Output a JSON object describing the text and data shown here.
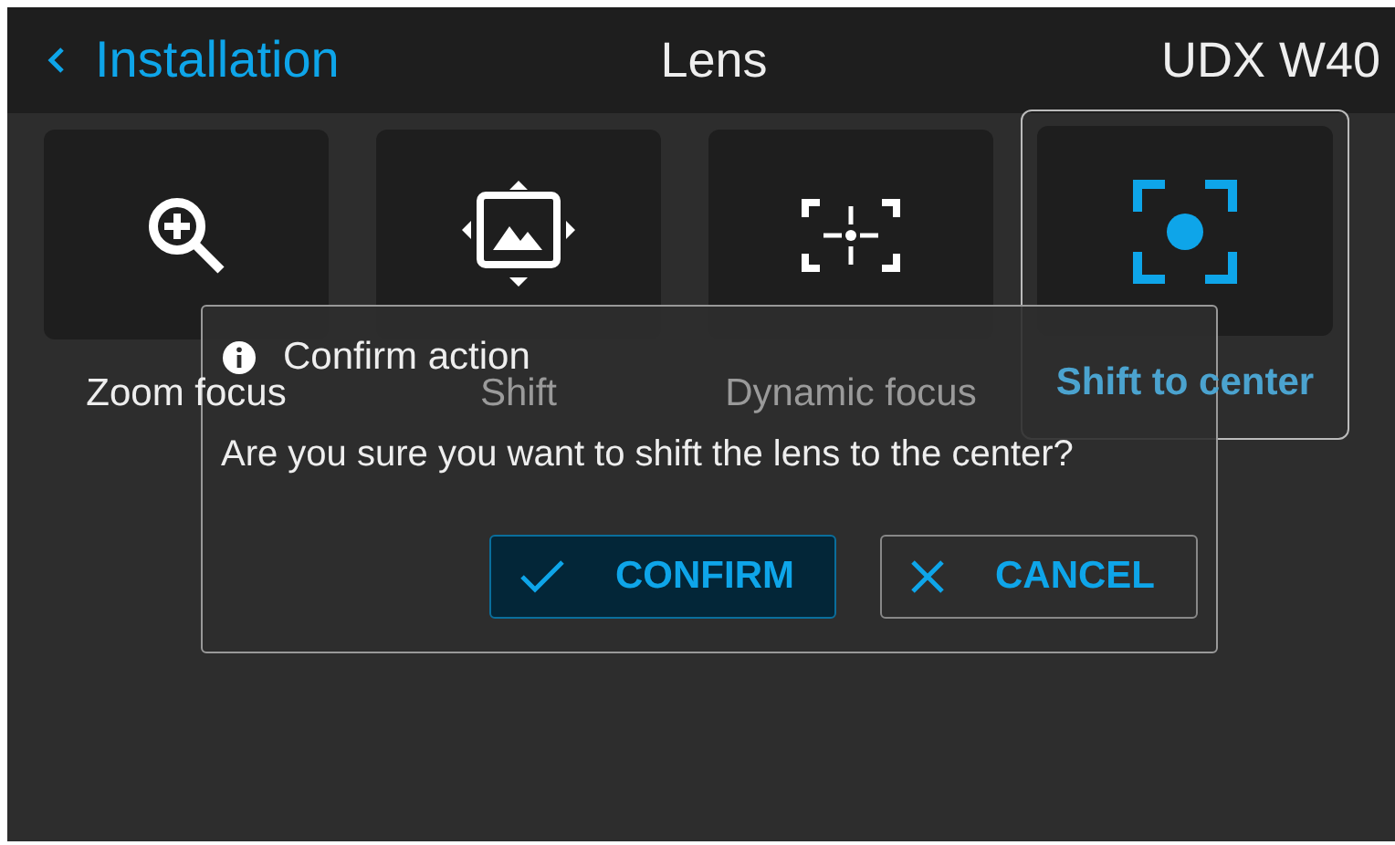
{
  "header": {
    "back_label": "Installation",
    "title": "Lens",
    "device": "UDX W40"
  },
  "tiles": [
    {
      "kind": "zoom",
      "label": "Zoom focus",
      "selected": false,
      "dimmed": false
    },
    {
      "kind": "shift",
      "label": "Shift",
      "selected": false,
      "dimmed": true
    },
    {
      "kind": "dynamic",
      "label": "Dynamic focus",
      "selected": false,
      "dimmed": true
    },
    {
      "kind": "center",
      "label": "Shift to center",
      "selected": true,
      "dimmed": true
    }
  ],
  "dialog": {
    "title": "Confirm action",
    "message": "Are you sure you want to shift the lens to the center?",
    "buttons": [
      {
        "kind": "confirm",
        "label": "CONFIRM",
        "selected": true
      },
      {
        "kind": "cancel",
        "label": "CANCEL",
        "selected": false
      }
    ]
  }
}
